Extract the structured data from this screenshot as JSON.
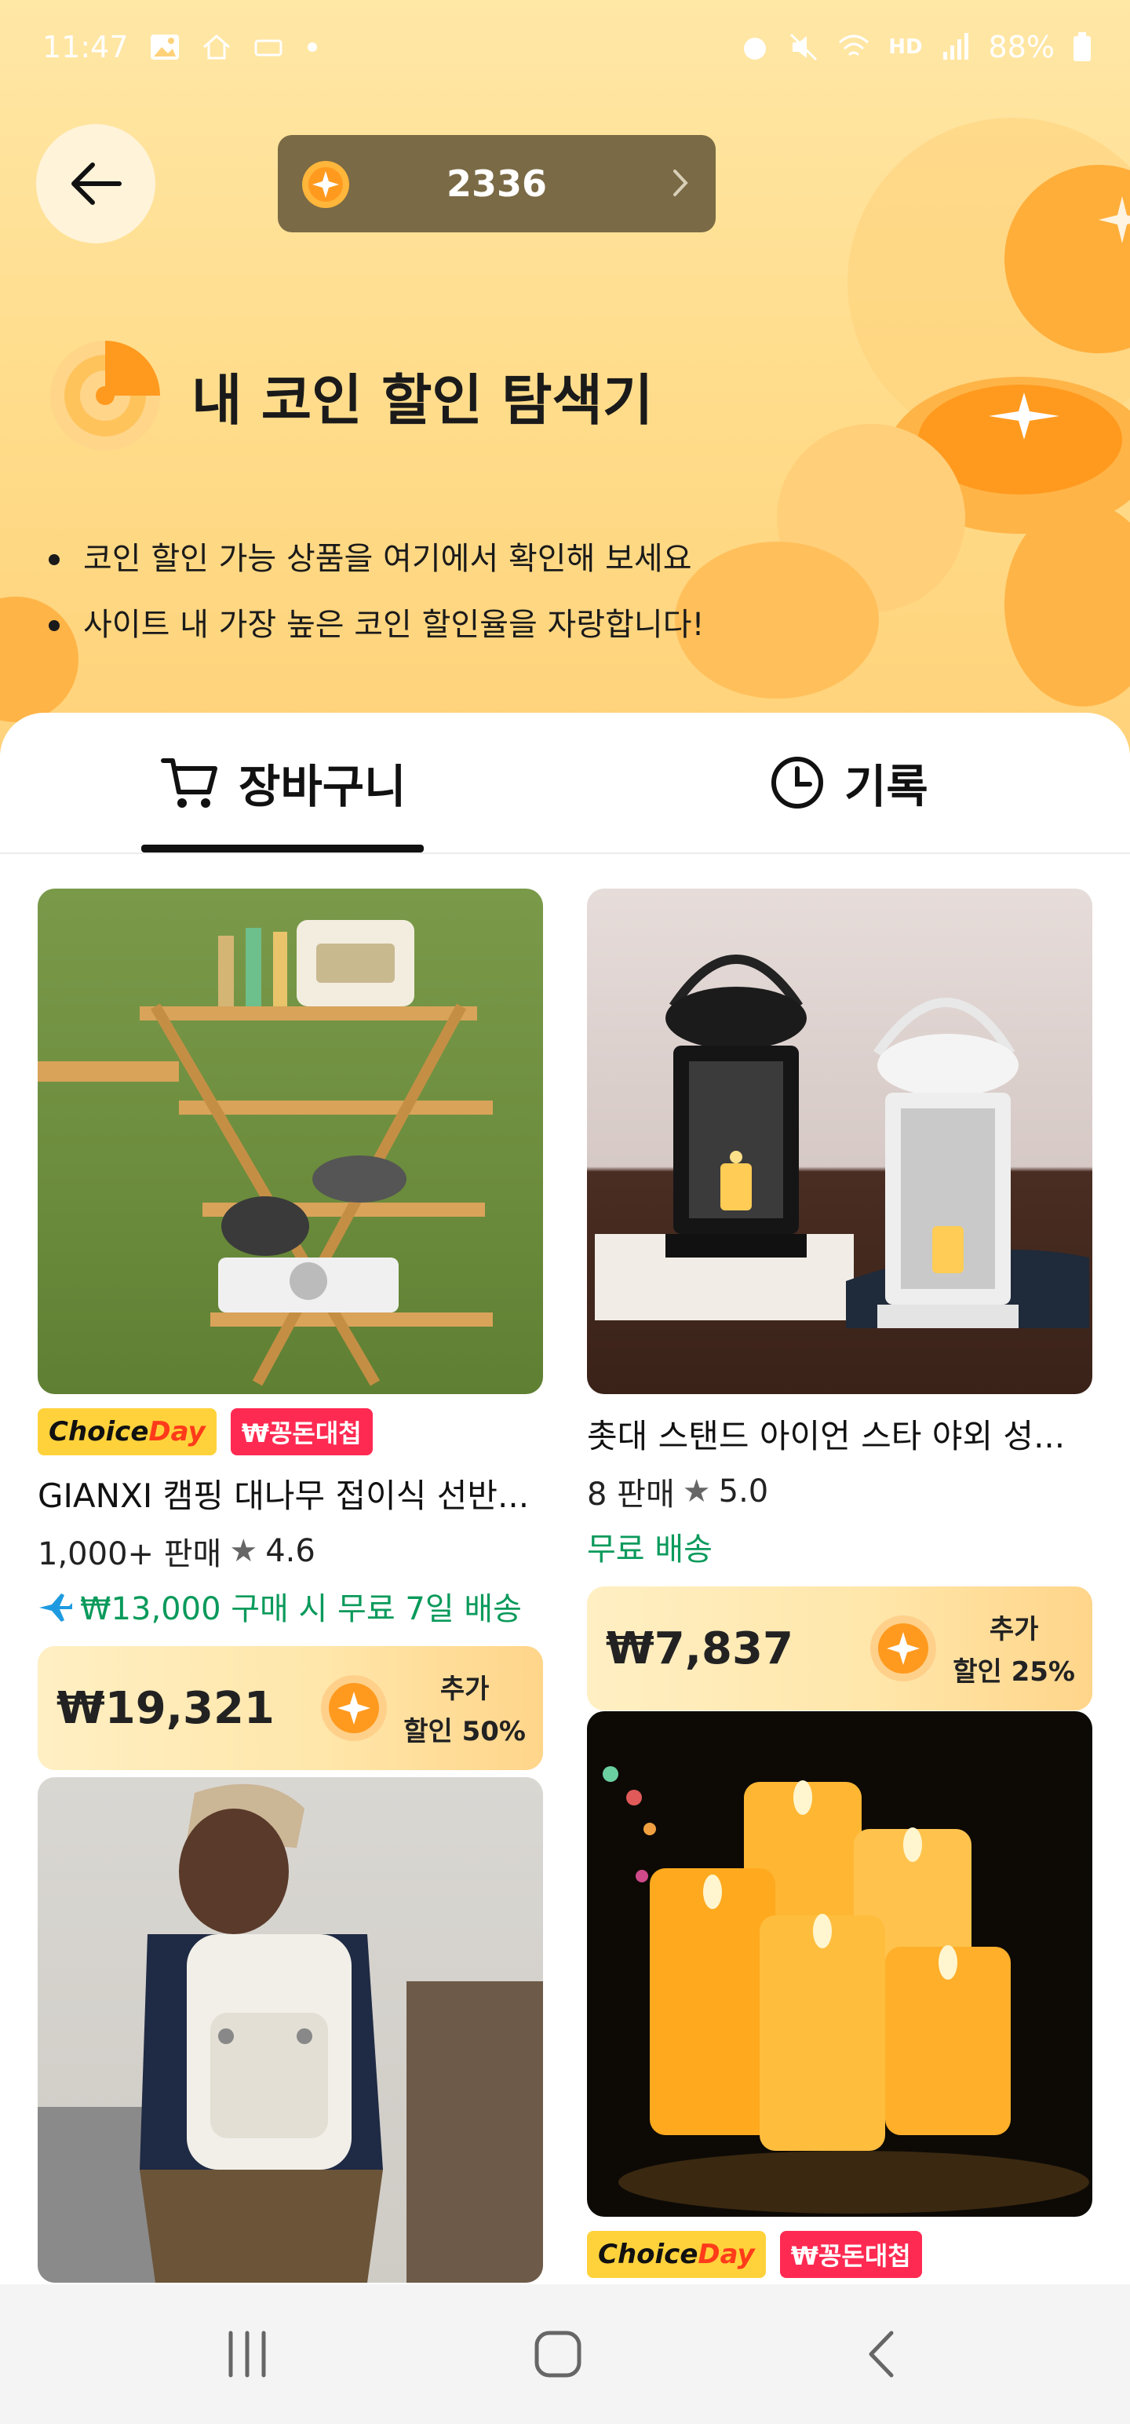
{
  "status_bar": {
    "time": "11:47",
    "battery": "88%",
    "hd_label": "HD"
  },
  "header": {
    "coin_count": "2336"
  },
  "hero": {
    "title": "내 코인 할인 탐색기",
    "bullets": [
      "코인 할인 가능 상품을 여기에서 확인해 보세요",
      "사이트 내 가장 높은 코인 할인율을 자랑합니다!"
    ]
  },
  "tabs": [
    {
      "label": "장바구니",
      "icon": "cart-icon",
      "active": true
    },
    {
      "label": "기록",
      "icon": "clock-icon",
      "active": false
    }
  ],
  "badges": {
    "choice": "Choice",
    "day": "Day",
    "sale": "₩꽁돈대첩"
  },
  "products": [
    {
      "title": "GIANXI 캠핑 대나무 접이식 선반...",
      "sales": "1,000+ 판매",
      "rating": "4.6",
      "shipping": "₩13,000 구매 시 무료 7일 배송",
      "price": "₩19,321",
      "discount_line1": "추가",
      "discount_line2": "할인 50%"
    },
    {
      "title": "촛대 스탠드 아이언 스타 야외 성...",
      "sales": "8 판매",
      "rating": "5.0",
      "shipping": "무료 배송",
      "price": "₩7,837",
      "discount_line1": "추가",
      "discount_line2": "할인 25%"
    }
  ],
  "colors": {
    "accent_orange": "#ff9a1f",
    "shipping_green": "#0a9a5b",
    "sale_red": "#ff2a52",
    "choice_yellow": "#ffd23c"
  }
}
